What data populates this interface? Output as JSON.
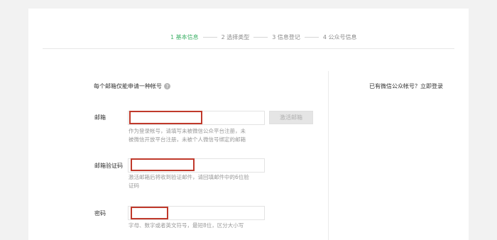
{
  "steps": [
    {
      "label": "1 基本信息",
      "active": true
    },
    {
      "label": "2 选择类型",
      "active": false
    },
    {
      "label": "3 信息登记",
      "active": false
    },
    {
      "label": "4 公众号信息",
      "active": false
    }
  ],
  "form": {
    "hint": "每个邮箱仅能申请一种帐号",
    "email": {
      "label": "邮箱",
      "value": "",
      "placeholder": "",
      "tip_line1": "作为登录帐号，请填写未被微信公众平台注册，未",
      "tip_line2": "被微信开放平台注册，未被个人微信号绑定的邮箱"
    },
    "activate_button": "激活邮箱",
    "code": {
      "label": "邮箱验证码",
      "value": "",
      "tip_line1": "激活邮箱后将收到验证邮件，请回填邮件中的6位验",
      "tip_line2": "证码"
    },
    "password": {
      "label": "密码",
      "value": "",
      "tip_line1": "字母、数字或者英文符号，最短8位，区分大小写"
    }
  },
  "side": {
    "prompt": "已有微信公众帐号？",
    "login_link": "立即登录"
  },
  "colors": {
    "active_step": "#43b36b",
    "highlight": "#c0392b"
  }
}
